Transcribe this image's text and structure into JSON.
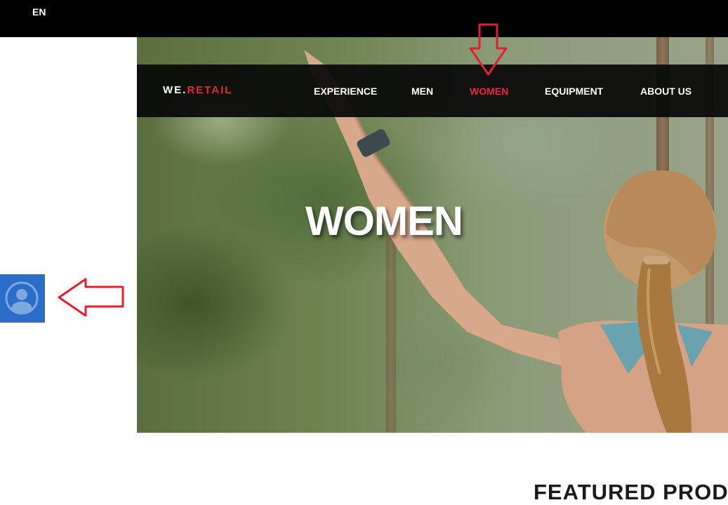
{
  "top_bar": {
    "language": "EN"
  },
  "logo": {
    "prefix": "WE.",
    "suffix": "RETAIL"
  },
  "nav": {
    "items": [
      {
        "label": "EXPERIENCE"
      },
      {
        "label": "MEN"
      },
      {
        "label": "WOMEN",
        "active": true
      },
      {
        "label": "EQUIPMENT"
      },
      {
        "label": "ABOUT US"
      }
    ]
  },
  "hero": {
    "title": "WOMEN"
  },
  "user_panel": {
    "icon": "user-avatar-icon"
  },
  "featured": {
    "heading": "FEATURED PROD"
  },
  "colors": {
    "accent": "#e8283a",
    "top_bar": "#000000",
    "nav_bg": "#080808",
    "user_tab": "#2b6ec9",
    "annotation_arrow": "#e0202c"
  },
  "annotations": [
    {
      "type": "arrow-down",
      "target": "nav-women"
    },
    {
      "type": "arrow-left",
      "target": "user-panel-toggle"
    }
  ]
}
